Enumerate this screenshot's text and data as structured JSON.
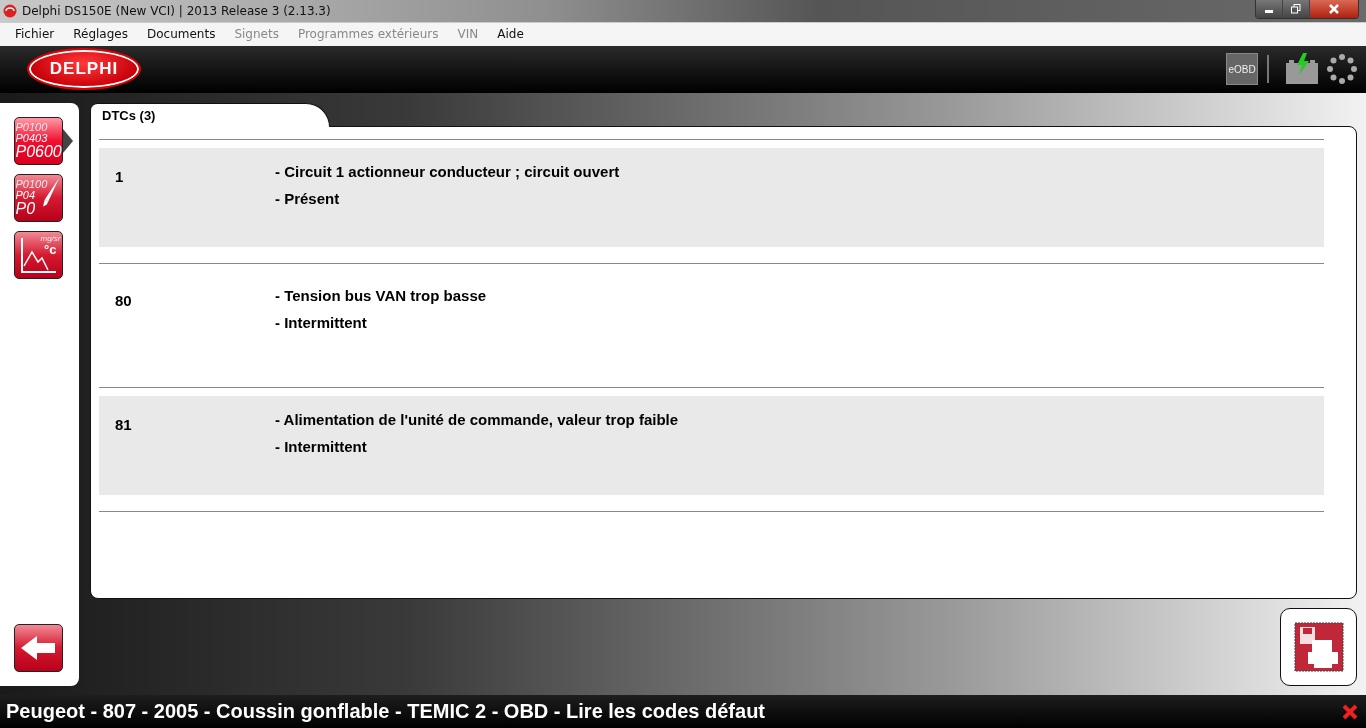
{
  "window": {
    "title": "Delphi DS150E (New VCI) | 2013 Release 3 (2.13.3)"
  },
  "menu": [
    {
      "label": "Fichier",
      "disabled": false
    },
    {
      "label": "Réglages",
      "disabled": false
    },
    {
      "label": "Documents",
      "disabled": false
    },
    {
      "label": "Signets",
      "disabled": true
    },
    {
      "label": "Programmes extérieurs",
      "disabled": true
    },
    {
      "label": "VIN",
      "disabled": true
    },
    {
      "label": "Aide",
      "disabled": false
    }
  ],
  "header": {
    "logo": "DELPHI",
    "eobd": "eOBD"
  },
  "sidebar": {
    "tools": [
      {
        "kind": "codes",
        "selected": true,
        "lines": [
          "P0100",
          "P0403",
          "P0600"
        ]
      },
      {
        "kind": "erase",
        "selected": false,
        "lines": [
          "P0100",
          "P04",
          "P0"
        ]
      },
      {
        "kind": "graph",
        "selected": false,
        "lines": [
          "mg/sr",
          "°c"
        ]
      }
    ]
  },
  "tabs": [
    {
      "label": "DTCs (3)",
      "selected": true
    }
  ],
  "dtcs": [
    {
      "code": "1",
      "description": "- Circuit 1 actionneur conducteur ; circuit ouvert",
      "status": "- Présent"
    },
    {
      "code": "80",
      "description": "- Tension bus VAN trop basse",
      "status": "- Intermittent"
    },
    {
      "code": "81",
      "description": "- Alimentation de l'unité de commande, valeur trop faible",
      "status": "- Intermittent"
    }
  ],
  "status_bar": {
    "text": "Peugeot - 807 - 2005 - Coussin gonflable - TEMIC 2 - OBD - Lire les codes défaut"
  }
}
